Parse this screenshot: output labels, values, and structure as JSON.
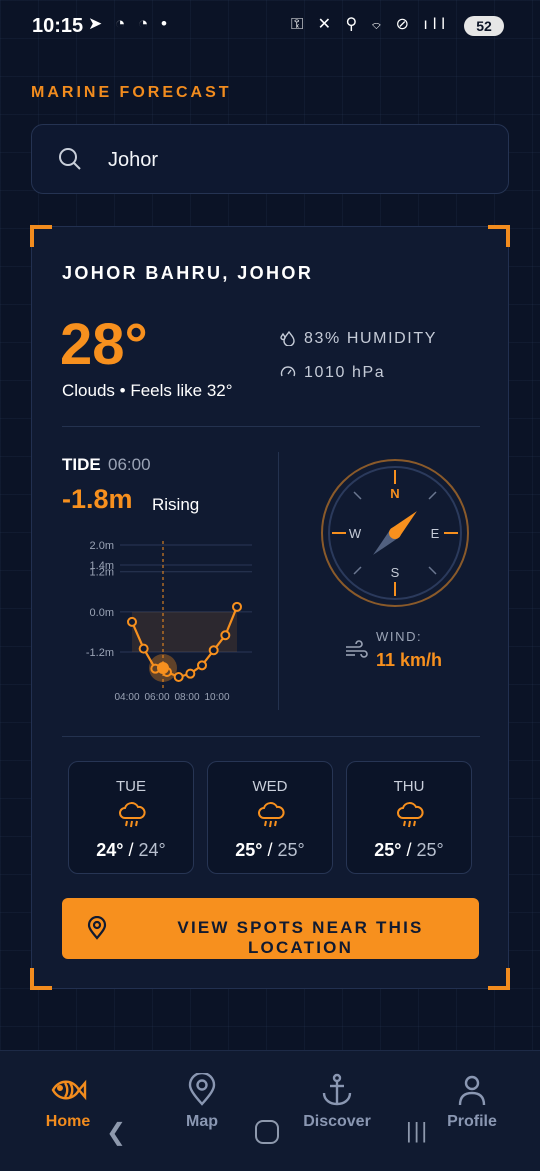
{
  "status_bar": {
    "time": "10:15",
    "battery": "52",
    "left_icons": "➤ ◔ ◔ •",
    "right_icons": "⚿ ✕ ⚲ ⌔ ⊘ ıll"
  },
  "header": {
    "title": "MARINE FORECAST"
  },
  "search": {
    "value": "Johor",
    "icon": "search-icon"
  },
  "location": {
    "name": "JOHOR BAHRU, JOHOR",
    "temperature": "28°",
    "description": "Clouds • Feels like 32°",
    "humidity": "83% HUMIDITY",
    "pressure": "1010 hPa"
  },
  "tide": {
    "label": "TIDE",
    "time": "06:00",
    "value": "-1.8m",
    "trend": "Rising",
    "chart_data": {
      "type": "line",
      "y_ticks": [
        "2.0m",
        "1.4m",
        "1.2m",
        "0.0m",
        "-1.2m"
      ],
      "y_tick_values": [
        2.0,
        1.4,
        1.2,
        0.0,
        -1.2
      ],
      "x_ticks": [
        "04:00",
        "06:00",
        "08:00",
        "10:00"
      ],
      "values": [
        -0.3,
        -1.1,
        -1.7,
        -1.8,
        -1.95,
        -1.85,
        -1.6,
        -1.15,
        -0.7,
        0.15
      ],
      "ylim": [
        -1.8,
        2.0
      ],
      "highlight_index": 3,
      "highlight_time": "06:00",
      "accent": "#f7901e"
    }
  },
  "compass": {
    "n": "N",
    "e": "E",
    "s": "S",
    "w": "W",
    "needle_deg": 45
  },
  "wind": {
    "label": "WIND:",
    "value": "11 km/h"
  },
  "forecast": [
    {
      "day": "TUE",
      "high": "24°",
      "low": "24°",
      "icon": "rain-cloud-icon"
    },
    {
      "day": "WED",
      "high": "25°",
      "low": "25°",
      "icon": "rain-cloud-icon"
    },
    {
      "day": "THU",
      "high": "25°",
      "low": "25°",
      "icon": "rain-cloud-icon"
    }
  ],
  "cta": {
    "label": "VIEW SPOTS NEAR THIS LOCATION",
    "icon": "location-pin-icon"
  },
  "nav": [
    {
      "label": "Home",
      "icon": "fish-icon",
      "active": true
    },
    {
      "label": "Map",
      "icon": "map-pin-icon",
      "active": false
    },
    {
      "label": "Discover",
      "icon": "anchor-icon",
      "active": false
    },
    {
      "label": "Profile",
      "icon": "user-icon",
      "active": false
    }
  ],
  "colors": {
    "accent": "#f7901e",
    "background": "#0b1326",
    "card": "#101a31"
  }
}
